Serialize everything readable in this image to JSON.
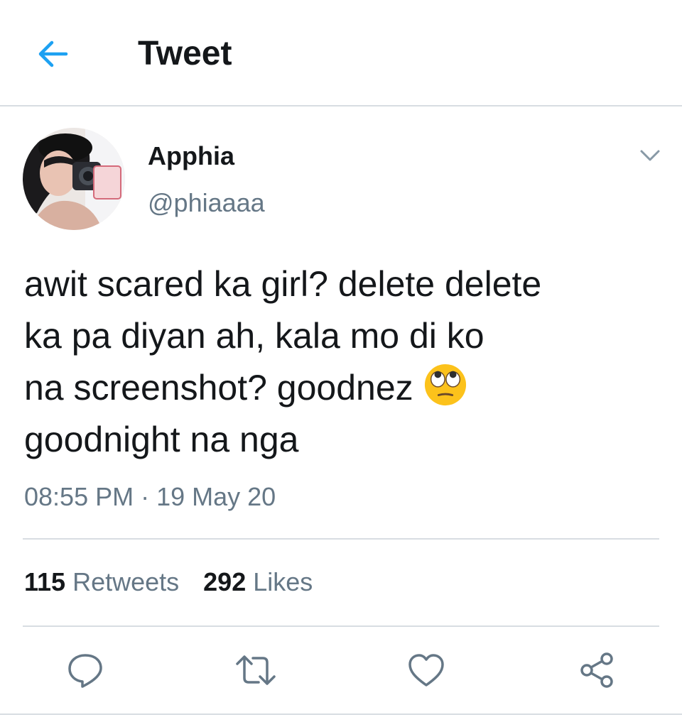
{
  "header": {
    "title": "Tweet"
  },
  "author": {
    "name": "Apphia",
    "handle": "@phiaaaa"
  },
  "tweet": {
    "line1": "awit scared ka girl? delete delete",
    "line2": "ka pa diyan ah, kala mo di ko",
    "line3": "na screenshot? goodnez ",
    "line4": "goodnight na nga",
    "emoji": "face-with-rolling-eyes"
  },
  "timestamp": "08:55 PM · 19 May 20",
  "stats": {
    "retweets_count": "115",
    "retweets_label": " Retweets",
    "likes_count": "292",
    "likes_label": " Likes"
  },
  "colors": {
    "accent": "#1da1f2",
    "text_primary": "#14171a",
    "text_secondary": "#657786",
    "border": "#d8dde2"
  }
}
